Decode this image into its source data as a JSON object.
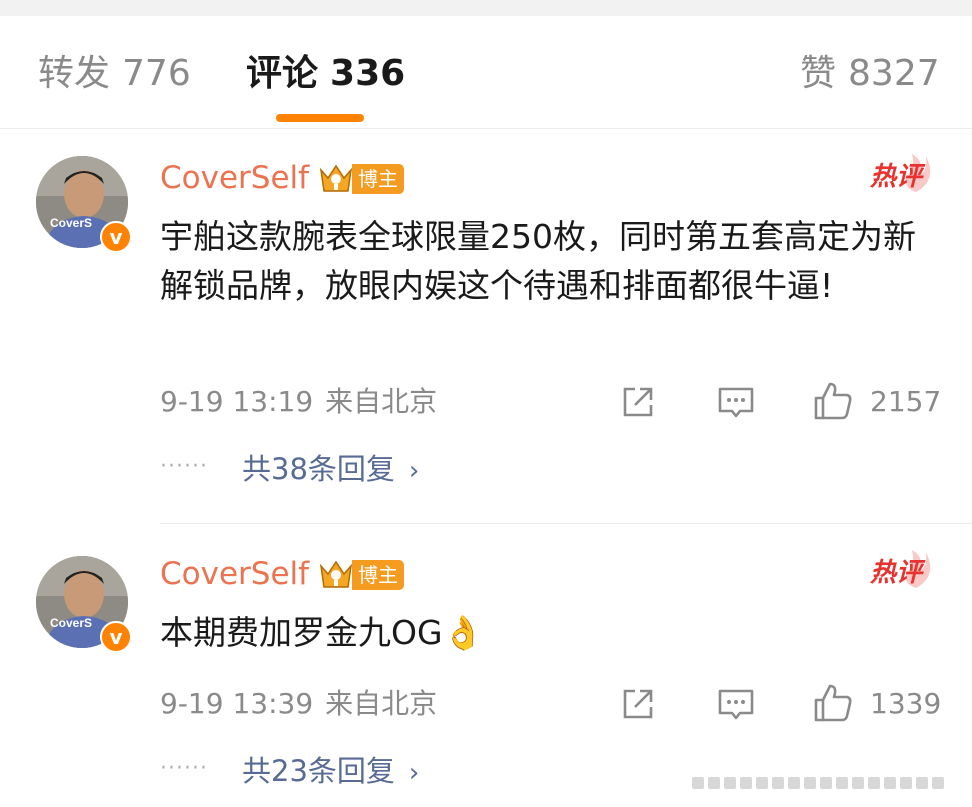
{
  "tabs": [
    {
      "label": "转发",
      "count": "776",
      "active": false
    },
    {
      "label": "评论",
      "count": "336",
      "active": true
    },
    {
      "label": "赞",
      "count": "8327",
      "active": false
    }
  ],
  "comments": [
    {
      "avatar_text": "CoverS",
      "verify_mark": "v",
      "username": "CoverSelf",
      "author_tag": "博主",
      "hot_tag": "热评",
      "text": "宇舶这款腕表全球限量250枚，同时第五套高定为新解锁品牌，放眼内娱这个待遇和排面都很牛逼!",
      "date": "9-19 13:19",
      "location": "来自北京",
      "likes": "2157",
      "dots": "······",
      "replies": "共38条回复",
      "chevron": "›"
    },
    {
      "avatar_text": "CoverS",
      "verify_mark": "v",
      "username": "CoverSelf",
      "author_tag": "博主",
      "hot_tag": "热评",
      "text": "本期费加罗金九OG👌",
      "date": "9-19 13:39",
      "location": "来自北京",
      "likes": "1339",
      "dots": "······",
      "replies": "共23条回复",
      "chevron": "›"
    }
  ],
  "colors": {
    "accent": "#ff8200",
    "username": "#eb7350",
    "reply_link": "#576b95",
    "hot": "#e8322f",
    "meta": "#8a8a8a"
  },
  "icons": [
    "share-icon",
    "comment-icon",
    "like-icon",
    "crown-icon",
    "hot-comment-icon",
    "verified-icon"
  ]
}
